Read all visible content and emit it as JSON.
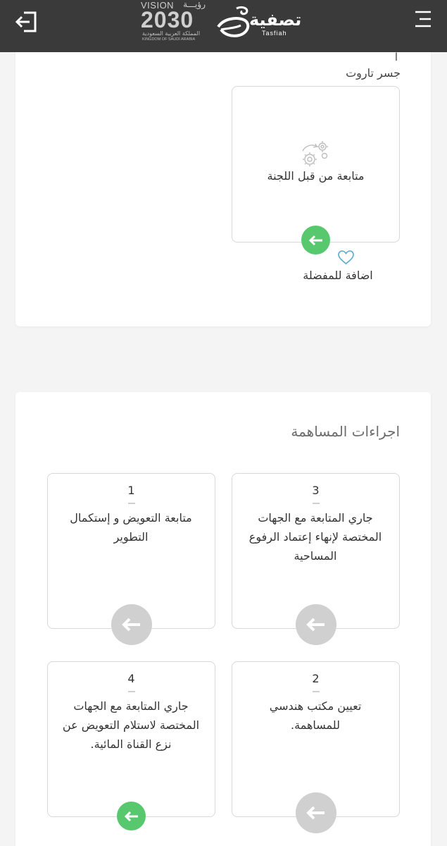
{
  "header": {
    "brand_name_ar": "تصفية",
    "brand_name_en": "Tasfiah",
    "vision": {
      "top_en": "VISION",
      "top_ar": "رؤيـــة",
      "year": "2030",
      "sub_ar": "المملكة العربية السعودية",
      "sub_en": "KINGDOM OF SAUDI ARABIA"
    },
    "login_icon": "login-icon",
    "menu_icon": "hamburger-menu-icon"
  },
  "project": {
    "cropped_text": "ا",
    "name": "جسر تاروت",
    "status_label": "متابعة من قبل اللجنة",
    "status_icon": "gears-icon",
    "favorite_label": "اضافة للمفضلة",
    "favorite_icon": "heart-icon"
  },
  "contribution": {
    "title": "اجراءات المساهمة",
    "steps": [
      {
        "number": "3",
        "text": "جاري المتابعة مع الجهات المختصة لإنهاء إعتماد الرفوع المساحية",
        "state": "pending"
      },
      {
        "number": "1",
        "text": "متابعة التعويض و إستكمال التطوير",
        "state": "pending"
      },
      {
        "number": "2",
        "text": "تعيين مكتب هندسي للمساهمة.",
        "state": "pending"
      },
      {
        "number": "4",
        "text": "جاري المتابعة مع الجهات المختصة لاستلام التعويض عن نزع القناة المائية.",
        "state": "active"
      }
    ]
  },
  "colors": {
    "header_bg": "#3a3a3a",
    "accent_green": "#57c86d",
    "inactive_grey": "#d0d0d0",
    "heart_blue": "#5aa9c9",
    "page_bg": "#f4f4f4"
  }
}
